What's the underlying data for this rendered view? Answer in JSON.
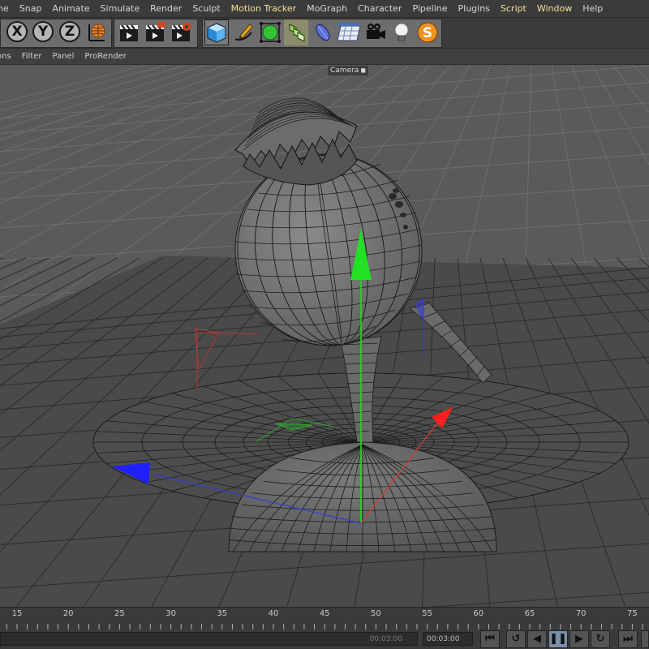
{
  "menu": {
    "items": [
      {
        "label": "ne",
        "hl": false
      },
      {
        "label": "Snap",
        "hl": false
      },
      {
        "label": "Animate",
        "hl": false
      },
      {
        "label": "Simulate",
        "hl": false
      },
      {
        "label": "Render",
        "hl": false
      },
      {
        "label": "Sculpt",
        "hl": false
      },
      {
        "label": "Motion Tracker",
        "hl": true
      },
      {
        "label": "MoGraph",
        "hl": false
      },
      {
        "label": "Character",
        "hl": false
      },
      {
        "label": "Pipeline",
        "hl": false
      },
      {
        "label": "Plugins",
        "hl": false
      },
      {
        "label": "Script",
        "hl": true
      },
      {
        "label": "Window",
        "hl": true
      },
      {
        "label": "Help",
        "hl": false
      }
    ]
  },
  "toolbar": {
    "axis_x": "X",
    "axis_y": "Y",
    "axis_z": "Z",
    "icons": [
      "world-coordinates-icon",
      "render-view-icon",
      "render-picture-viewer-icon",
      "render-settings-icon",
      "cube-icon",
      "pen-icon",
      "subdivision-icon",
      "array-icon",
      "deformer-icon",
      "floor-icon",
      "camera-icon",
      "light-icon",
      "script-s-icon"
    ]
  },
  "view_menu": {
    "items": [
      "ons",
      "Filter",
      "Panel",
      "ProRender"
    ]
  },
  "viewport": {
    "camera_label": "Camera"
  },
  "timeline": {
    "ticks": [
      "15",
      "20",
      "25",
      "30",
      "35",
      "40",
      "45",
      "50",
      "55",
      "60",
      "65",
      "70",
      "75"
    ]
  },
  "transport": {
    "current_time": "00:03:00",
    "end_time": "00:03:00"
  },
  "colors": {
    "axis_x": "#ff1f1f",
    "axis_y": "#22e022",
    "axis_z": "#2020ff",
    "menu_highlight": "#f4e39a"
  }
}
